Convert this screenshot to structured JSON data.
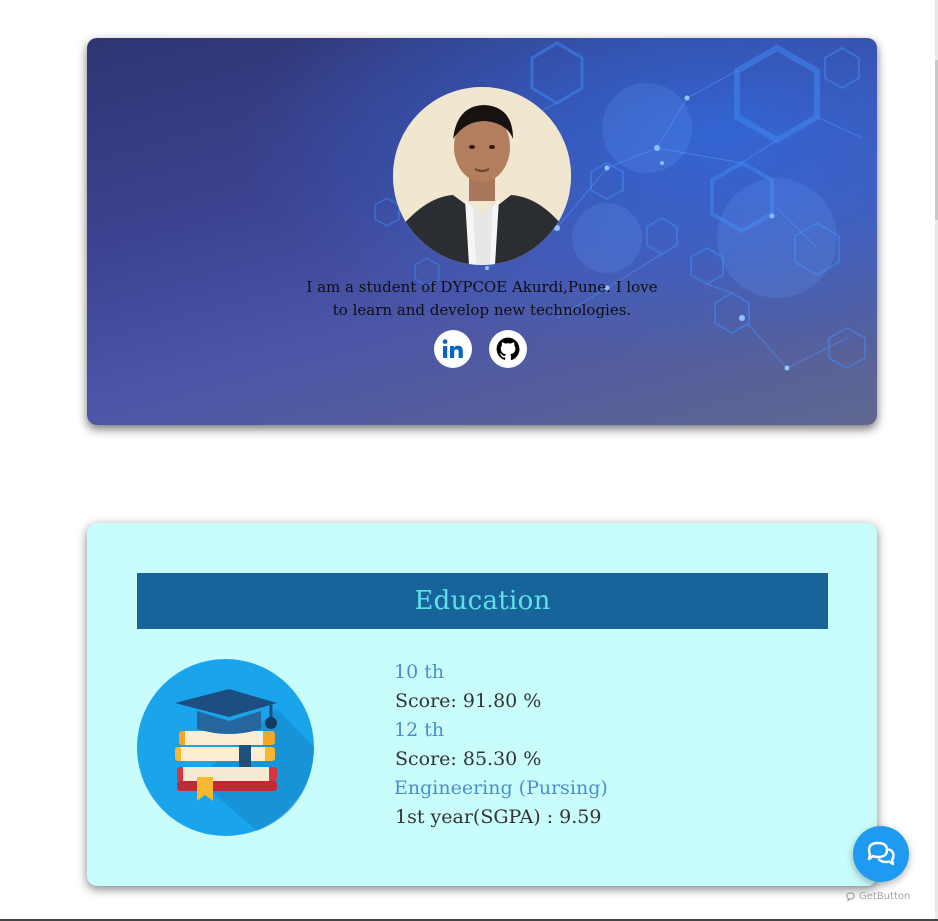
{
  "profile": {
    "bio": "I am a student of DYPCOE Akurdi,Pune. I love to learn and develop new technologies.",
    "social": [
      {
        "name": "linkedin",
        "icon": "linkedin-icon",
        "color": "#0a66c2"
      },
      {
        "name": "github",
        "icon": "github-icon",
        "color": "#000000"
      }
    ]
  },
  "education": {
    "title": "Education",
    "icon": "graduation-books-icon",
    "entries": [
      {
        "level": "10 th",
        "score": "Score: 91.80 %"
      },
      {
        "level": "12 th",
        "score": "Score: 85.30 %"
      },
      {
        "level": "Engineering (Pursing)",
        "score": "1st year(SGPA) : 9.59"
      }
    ]
  },
  "chat_widget": {
    "icon": "chat-bubbles-icon",
    "brand": "GetButton",
    "color": "#1e9af0"
  },
  "colors": {
    "education_header_bg": "#17649b",
    "education_title": "#5fe0e7",
    "education_card_bg": "#c9fdfb",
    "level_text": "#4a8fc7"
  }
}
